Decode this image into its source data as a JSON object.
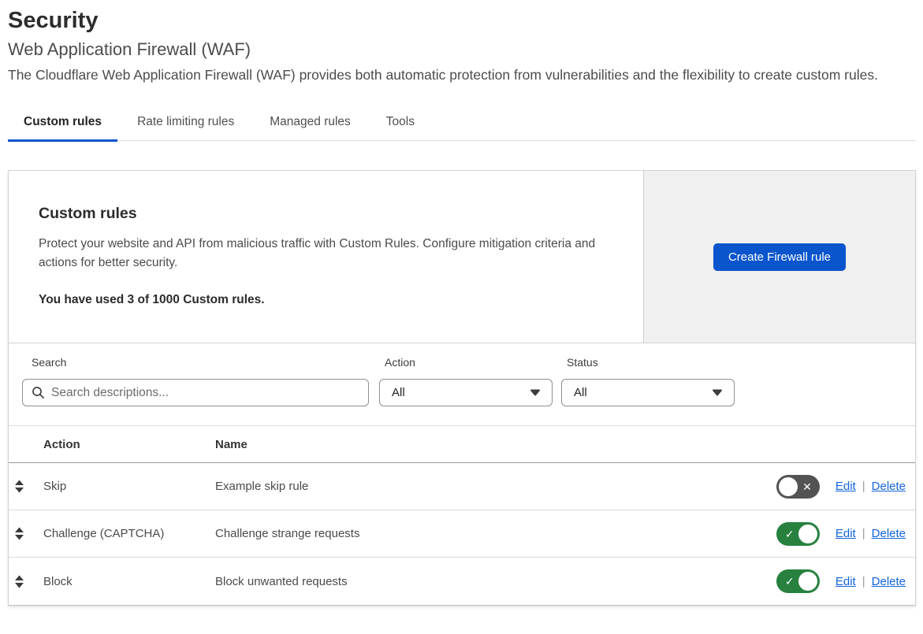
{
  "page": {
    "title": "Security",
    "subtitle": "Web Application Firewall (WAF)",
    "description": "The Cloudflare Web Application Firewall (WAF) provides both automatic protection from vulnerabilities and the flexibility to create custom rules."
  },
  "tabs": [
    {
      "label": "Custom rules",
      "active": true
    },
    {
      "label": "Rate limiting rules",
      "active": false
    },
    {
      "label": "Managed rules",
      "active": false
    },
    {
      "label": "Tools",
      "active": false
    }
  ],
  "panel": {
    "heading": "Custom rules",
    "description": "Protect your website and API from malicious traffic with Custom Rules. Configure mitigation criteria and actions for better security.",
    "usage": "You have used 3 of 1000 Custom rules.",
    "create_button": "Create Firewall rule"
  },
  "filters": {
    "search_label": "Search",
    "search_placeholder": "Search descriptions...",
    "search_value": "",
    "action_label": "Action",
    "action_value": "All",
    "status_label": "Status",
    "status_value": "All"
  },
  "table": {
    "columns": [
      "Action",
      "Name"
    ],
    "rows": [
      {
        "action": "Skip",
        "name": "Example skip rule",
        "enabled": false
      },
      {
        "action": "Challenge (CAPTCHA)",
        "name": "Challenge strange requests",
        "enabled": true
      },
      {
        "action": "Block",
        "name": "Block unwanted requests",
        "enabled": true
      }
    ],
    "edit_label": "Edit",
    "delete_label": "Delete",
    "separator": "|"
  },
  "colors": {
    "accent_blue": "#0b55cc",
    "link_blue": "#1264da",
    "toggle_on": "#28813f",
    "toggle_off": "#535353",
    "panel_bg": "#f0f0f0"
  }
}
